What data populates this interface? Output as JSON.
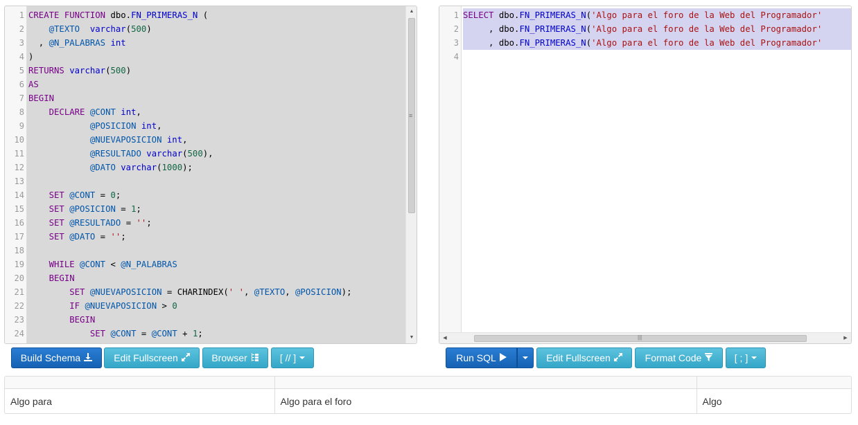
{
  "schema_editor": {
    "lines": [
      {
        "n": "1",
        "tokens": [
          [
            "kw",
            "CREATE FUNCTION "
          ],
          [
            "op",
            "dbo."
          ],
          [
            "fn",
            "FN_PRIMERAS_N"
          ],
          [
            "op",
            " ("
          ]
        ]
      },
      {
        "n": "2",
        "tokens": [
          [
            "op",
            "    "
          ],
          [
            "vr",
            "@TEXTO"
          ],
          [
            "op",
            "  "
          ],
          [
            "ty",
            "varchar"
          ],
          [
            "op",
            "("
          ],
          [
            "nm",
            "500"
          ],
          [
            "op",
            ")"
          ]
        ]
      },
      {
        "n": "3",
        "tokens": [
          [
            "op",
            "  , "
          ],
          [
            "vr",
            "@N_PALABRAS"
          ],
          [
            "op",
            " "
          ],
          [
            "ty",
            "int"
          ]
        ]
      },
      {
        "n": "4",
        "tokens": [
          [
            "op",
            ")"
          ]
        ]
      },
      {
        "n": "5",
        "tokens": [
          [
            "kw",
            "RETURNS "
          ],
          [
            "ty",
            "varchar"
          ],
          [
            "op",
            "("
          ],
          [
            "nm",
            "500"
          ],
          [
            "op",
            ")"
          ]
        ]
      },
      {
        "n": "6",
        "tokens": [
          [
            "kw",
            "AS"
          ]
        ]
      },
      {
        "n": "7",
        "tokens": [
          [
            "kw",
            "BEGIN"
          ]
        ]
      },
      {
        "n": "8",
        "tokens": [
          [
            "op",
            "    "
          ],
          [
            "kw",
            "DECLARE "
          ],
          [
            "vr",
            "@CONT"
          ],
          [
            "op",
            " "
          ],
          [
            "ty",
            "int"
          ],
          [
            "op",
            ","
          ]
        ]
      },
      {
        "n": "9",
        "tokens": [
          [
            "op",
            "            "
          ],
          [
            "vr",
            "@POSICION"
          ],
          [
            "op",
            " "
          ],
          [
            "ty",
            "int"
          ],
          [
            "op",
            ","
          ]
        ]
      },
      {
        "n": "10",
        "tokens": [
          [
            "op",
            "            "
          ],
          [
            "vr",
            "@NUEVAPOSICION"
          ],
          [
            "op",
            " "
          ],
          [
            "ty",
            "int"
          ],
          [
            "op",
            ","
          ]
        ]
      },
      {
        "n": "11",
        "tokens": [
          [
            "op",
            "            "
          ],
          [
            "vr",
            "@RESULTADO"
          ],
          [
            "op",
            " "
          ],
          [
            "ty",
            "varchar"
          ],
          [
            "op",
            "("
          ],
          [
            "nm",
            "500"
          ],
          [
            "op",
            "),"
          ]
        ]
      },
      {
        "n": "12",
        "tokens": [
          [
            "op",
            "            "
          ],
          [
            "vr",
            "@DATO"
          ],
          [
            "op",
            " "
          ],
          [
            "ty",
            "varchar"
          ],
          [
            "op",
            "("
          ],
          [
            "nm",
            "1000"
          ],
          [
            "op",
            ");"
          ]
        ]
      },
      {
        "n": "13",
        "tokens": []
      },
      {
        "n": "14",
        "tokens": [
          [
            "op",
            "    "
          ],
          [
            "kw",
            "SET "
          ],
          [
            "vr",
            "@CONT"
          ],
          [
            "op",
            " = "
          ],
          [
            "nm",
            "0"
          ],
          [
            "op",
            ";"
          ]
        ]
      },
      {
        "n": "15",
        "tokens": [
          [
            "op",
            "    "
          ],
          [
            "kw",
            "SET "
          ],
          [
            "vr",
            "@POSICION"
          ],
          [
            "op",
            " = "
          ],
          [
            "nm",
            "1"
          ],
          [
            "op",
            ";"
          ]
        ]
      },
      {
        "n": "16",
        "tokens": [
          [
            "op",
            "    "
          ],
          [
            "kw",
            "SET "
          ],
          [
            "vr",
            "@RESULTADO"
          ],
          [
            "op",
            " = "
          ],
          [
            "st",
            "''"
          ],
          [
            "op",
            ";"
          ]
        ]
      },
      {
        "n": "17",
        "tokens": [
          [
            "op",
            "    "
          ],
          [
            "kw",
            "SET "
          ],
          [
            "vr",
            "@DATO"
          ],
          [
            "op",
            " = "
          ],
          [
            "st",
            "''"
          ],
          [
            "op",
            ";"
          ]
        ]
      },
      {
        "n": "18",
        "tokens": []
      },
      {
        "n": "19",
        "tokens": [
          [
            "op",
            "    "
          ],
          [
            "kw",
            "WHILE "
          ],
          [
            "vr",
            "@CONT"
          ],
          [
            "op",
            " < "
          ],
          [
            "vr",
            "@N_PALABRAS"
          ]
        ]
      },
      {
        "n": "20",
        "tokens": [
          [
            "op",
            "    "
          ],
          [
            "kw",
            "BEGIN"
          ]
        ]
      },
      {
        "n": "21",
        "tokens": [
          [
            "op",
            "        "
          ],
          [
            "kw",
            "SET "
          ],
          [
            "vr",
            "@NUEVAPOSICION"
          ],
          [
            "op",
            " = CHARINDEX("
          ],
          [
            "st",
            "' '"
          ],
          [
            "op",
            ", "
          ],
          [
            "vr",
            "@TEXTO"
          ],
          [
            "op",
            ", "
          ],
          [
            "vr",
            "@POSICION"
          ],
          [
            "op",
            ");"
          ]
        ]
      },
      {
        "n": "22",
        "tokens": [
          [
            "op",
            "        "
          ],
          [
            "kw",
            "IF "
          ],
          [
            "vr",
            "@NUEVAPOSICION"
          ],
          [
            "op",
            " > "
          ],
          [
            "nm",
            "0"
          ]
        ]
      },
      {
        "n": "23",
        "tokens": [
          [
            "op",
            "        "
          ],
          [
            "kw",
            "BEGIN"
          ]
        ]
      },
      {
        "n": "24",
        "tokens": [
          [
            "op",
            "            "
          ],
          [
            "kw",
            "SET "
          ],
          [
            "vr",
            "@CONT"
          ],
          [
            "op",
            " = "
          ],
          [
            "vr",
            "@CONT"
          ],
          [
            "op",
            " + "
          ],
          [
            "nm",
            "1"
          ],
          [
            "op",
            ";"
          ]
        ]
      }
    ]
  },
  "sql_editor": {
    "lines": [
      {
        "n": "1",
        "hl": true,
        "tokens": [
          [
            "kw",
            "SELECT "
          ],
          [
            "op",
            "dbo."
          ],
          [
            "fn",
            "FN_PRIMERAS_N"
          ],
          [
            "op",
            "("
          ],
          [
            "st",
            "'Algo para el foro de la Web del Programador'"
          ]
        ]
      },
      {
        "n": "2",
        "hl": true,
        "tokens": [
          [
            "op",
            "     , dbo."
          ],
          [
            "fn",
            "FN_PRIMERAS_N"
          ],
          [
            "op",
            "("
          ],
          [
            "st",
            "'Algo para el foro de la Web del Programador'"
          ]
        ]
      },
      {
        "n": "3",
        "hl": true,
        "tokens": [
          [
            "op",
            "     , dbo."
          ],
          [
            "fn",
            "FN_PRIMERAS_N"
          ],
          [
            "op",
            "("
          ],
          [
            "st",
            "'Algo para el foro de la Web del Programador'"
          ]
        ]
      },
      {
        "n": "4",
        "hl": false,
        "tokens": []
      }
    ]
  },
  "schema_buttons": {
    "build_schema": "Build Schema",
    "edit_fullscreen": "Edit Fullscreen",
    "browser": "Browser",
    "delimiter": "[ // ]"
  },
  "sql_buttons": {
    "run_sql": "Run SQL",
    "edit_fullscreen": "Edit Fullscreen",
    "format_code": "Format Code",
    "delimiter": "[ ; ]"
  },
  "results": {
    "headers": [
      "",
      "",
      ""
    ],
    "rows": [
      [
        "Algo para",
        "Algo para el foro",
        "Algo"
      ]
    ]
  },
  "icons": {
    "build": "download-icon",
    "fullscreen": "expand-icon",
    "browser": "tree-icon",
    "run": "play-icon",
    "format": "filter-icon"
  }
}
